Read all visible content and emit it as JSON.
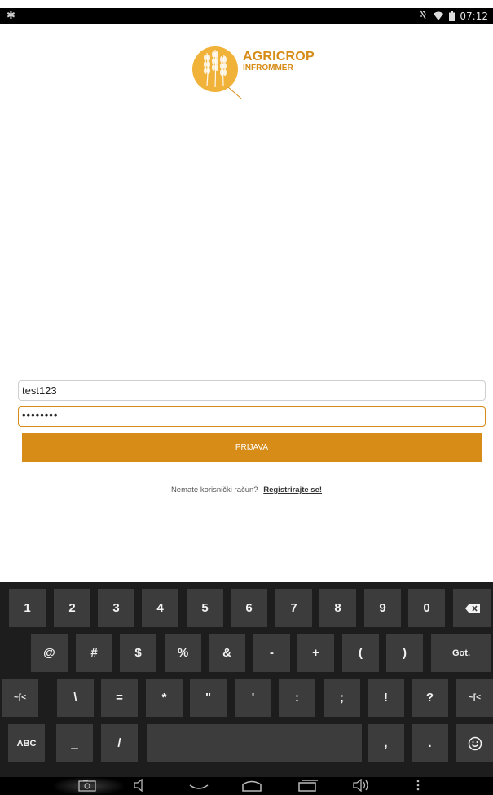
{
  "status_bar": {
    "time": "07:12",
    "left_icon": "debug-icon",
    "icons": [
      "mute-icon",
      "wifi-icon",
      "battery-icon"
    ]
  },
  "logo": {
    "line1": "AGRICROP",
    "line2": "INFROMMER"
  },
  "form": {
    "username_value": "test123",
    "password_value": "••••••••",
    "login_label": "PRIJAVA",
    "register_prompt": "Nemate korisnički račun?",
    "register_link": "Registrirajte se!"
  },
  "keyboard": {
    "row1": [
      "1",
      "2",
      "3",
      "4",
      "5",
      "6",
      "7",
      "8",
      "9",
      "0"
    ],
    "row2": [
      "@",
      "#",
      "$",
      "%",
      "&",
      "-",
      "+",
      "(",
      ")"
    ],
    "row2_action": "Got.",
    "row3_left": "~[<",
    "row3": [
      "\\",
      "=",
      "*",
      "\"",
      "'",
      ":",
      ";",
      "!",
      "?"
    ],
    "row3_right": "~[<",
    "row4": {
      "abc": "ABC",
      "underscore": "_",
      "slash": "/",
      "comma": ",",
      "period": "."
    },
    "backspace_icon": "backspace-icon",
    "emoji_icon": "emoji-icon"
  },
  "nav_bar": {
    "icons": [
      "screenshot-icon",
      "volume-down-icon",
      "back-icon",
      "home-icon",
      "recents-icon",
      "volume-up-icon",
      "menu-icon"
    ]
  },
  "colors": {
    "accent": "#d68c16",
    "keyboard_bg": "#1d1d1d",
    "key_bg": "#3c3c3c"
  }
}
